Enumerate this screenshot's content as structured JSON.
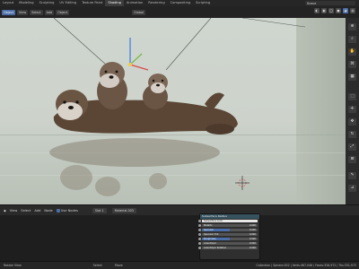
{
  "workspaces": [
    "Layout",
    "Modeling",
    "Sculpting",
    "UV Editing",
    "Texture Paint",
    "Shading",
    "Animation",
    "Rendering",
    "Compositing",
    "Scripting"
  ],
  "active_workspace": "Shading",
  "scene_name": "Scene",
  "viewport_header": {
    "mode": "Object",
    "menus": [
      "View",
      "Select",
      "Add",
      "Object"
    ],
    "transform": "Global"
  },
  "node_editor": {
    "menus": [
      "View",
      "Select",
      "Add",
      "Node"
    ],
    "use_nodes_label": "Use Nodes",
    "slot": "Slot 1",
    "material": "Material.003",
    "node_title": "Subsurface Radius",
    "node_rows": [
      {
        "label": "Subsurface Color",
        "value": "",
        "fill": 1.0,
        "light": true
      },
      {
        "label": "Metallic",
        "value": "0.000",
        "fill": 0.0
      },
      {
        "label": "Specular",
        "value": "0.500",
        "fill": 0.5
      },
      {
        "label": "Specular Tint",
        "value": "0.000",
        "fill": 0.0
      },
      {
        "label": "Roughness",
        "value": "0.500",
        "fill": 0.5
      },
      {
        "label": "Anisotropic",
        "value": "0.000",
        "fill": 0.0
      },
      {
        "label": "Anisotropic Rotation",
        "value": "0.000",
        "fill": 0.0
      }
    ]
  },
  "statusbar": {
    "left": [
      "Rotate View",
      "Select",
      "Move"
    ],
    "right": "Collection | Sphere.002 | Verts:467,046 | Faces:326,972 | Tris:331,972"
  },
  "colors": {
    "accent": "#4b6ea8",
    "otter_dark": "#5b4636",
    "otter_light": "#d9d2c8"
  }
}
